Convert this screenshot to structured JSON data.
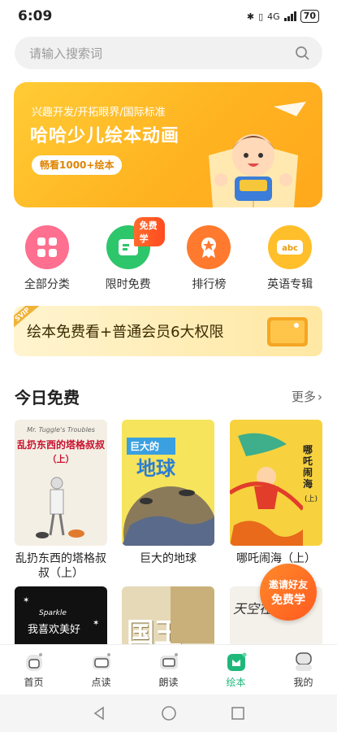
{
  "status": {
    "time": "6:09",
    "battery": "70",
    "network": "4G"
  },
  "search": {
    "placeholder": "请输入搜索词"
  },
  "banner": {
    "subtitle": "兴趣开发/开拓眼界/国际标准",
    "title": "哈哈少儿绘本动画",
    "pill": "畅看1000+绘本"
  },
  "categories": [
    {
      "label": "全部分类",
      "icon": "grid-icon",
      "color": "#ff6f8f"
    },
    {
      "label": "限时免费",
      "icon": "book-icon",
      "color": "#2ec66b",
      "tag": "免费学"
    },
    {
      "label": "排行榜",
      "icon": "ribbon-icon",
      "color": "#ff7a2e"
    },
    {
      "label": "英语专辑",
      "icon": "abc-icon",
      "color": "#ffbf2a"
    }
  ],
  "vip": {
    "badge": "SVIP",
    "text": "绘本免费看+普通会员6大权限"
  },
  "today_free": {
    "heading": "今日免费",
    "more": "更多"
  },
  "books": [
    {
      "title": "乱扔东西的塔格叔叔（上）",
      "cover_title": "乱扔东西的塔格叔叔",
      "cover_sub": "（上）",
      "cover_en": "Mr. Tuggle's Troubles"
    },
    {
      "title": "巨大的地球",
      "cover_title": "巨大的",
      "cover_big": "地球"
    },
    {
      "title": "哪吒闹海（上）",
      "cover_title": "哪吒闹海",
      "cover_sub": "(上)"
    },
    {
      "cover_en": "Sparkle",
      "cover_title": "我喜欢美好"
    },
    {
      "cover_title": "国王"
    },
    {
      "cover_title": "天空在我家"
    }
  ],
  "invite": {
    "line1": "邀请好友",
    "line2": "免费学"
  },
  "tabs": [
    {
      "label": "首页",
      "icon": "home-icon"
    },
    {
      "label": "点读",
      "icon": "read-icon"
    },
    {
      "label": "朗读",
      "icon": "tv-icon"
    },
    {
      "label": "绘本",
      "icon": "picture-book-icon",
      "active": true
    },
    {
      "label": "我的",
      "icon": "profile-icon"
    }
  ],
  "colors": {
    "accent": "#1fb87a",
    "banner": "#ffb321"
  }
}
